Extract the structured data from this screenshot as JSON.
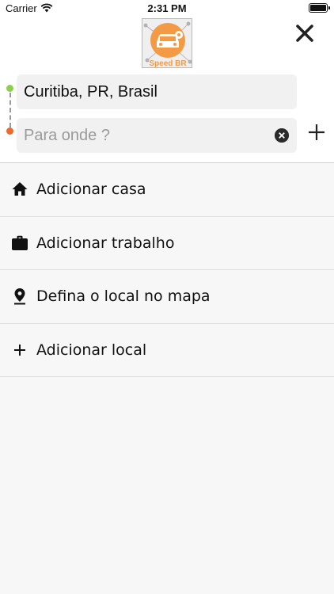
{
  "status_bar": {
    "carrier": "Carrier",
    "time": "2:31 PM"
  },
  "header": {
    "logo_text": "Speed BR",
    "origin_value": "Curitiba, PR, Brasil",
    "destination_placeholder": "Para onde ?"
  },
  "menu": {
    "items": [
      {
        "label": "Adicionar casa",
        "icon": "home-icon"
      },
      {
        "label": "Adicionar trabalho",
        "icon": "briefcase-icon"
      },
      {
        "label": "Defina o local no mapa",
        "icon": "map-pin-icon"
      },
      {
        "label": "Adicionar local",
        "icon": "plus-icon"
      }
    ]
  },
  "colors": {
    "origin_dot": "#8bd24a",
    "destination_dot": "#f0692b",
    "logo_orange": "#f39a45"
  }
}
